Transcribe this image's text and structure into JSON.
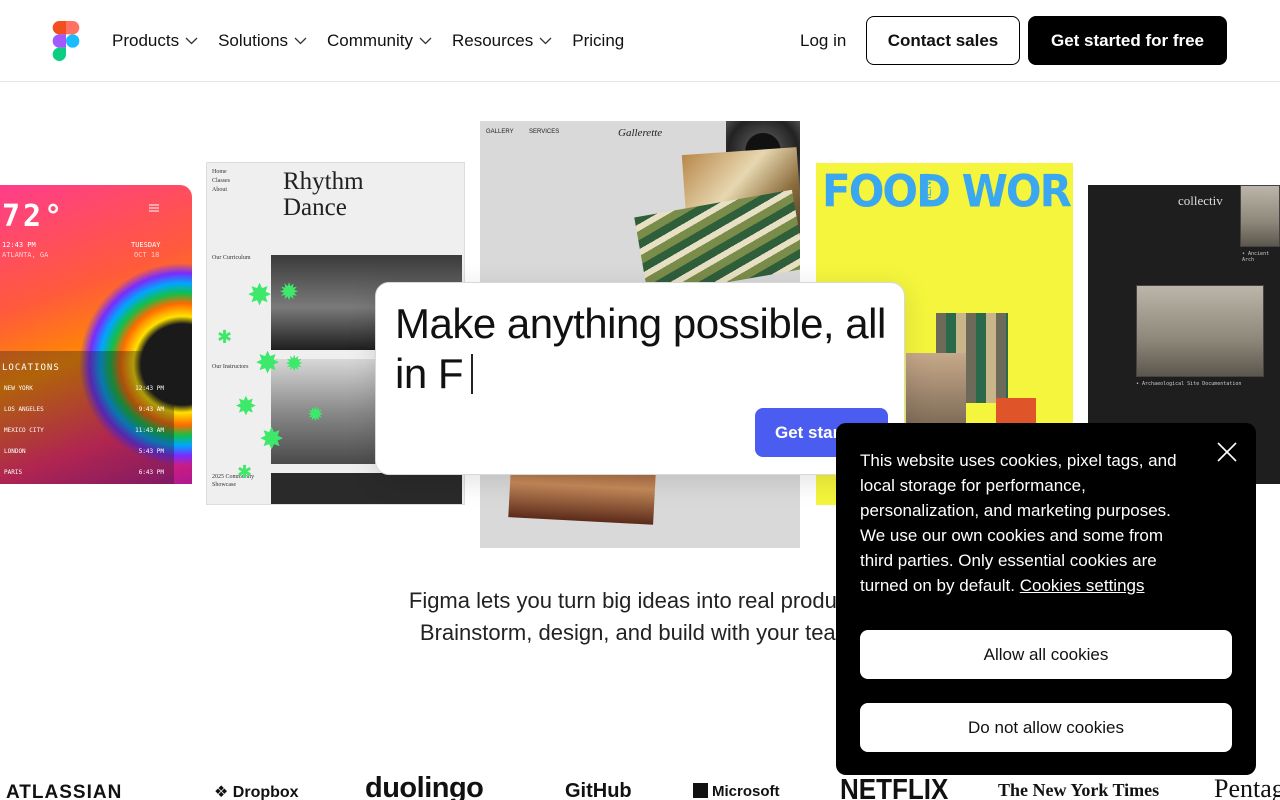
{
  "header": {
    "nav": [
      {
        "label": "Products",
        "dropdown": true
      },
      {
        "label": "Solutions",
        "dropdown": true
      },
      {
        "label": "Community",
        "dropdown": true
      },
      {
        "label": "Resources",
        "dropdown": true
      },
      {
        "label": "Pricing",
        "dropdown": false
      }
    ],
    "login": "Log in",
    "contact_sales": "Contact sales",
    "get_started": "Get started for free"
  },
  "collage": {
    "weather": {
      "temp": "72°",
      "time": "12:43 PM",
      "city": "ATLANTA, GA",
      "day": "TUESDAY",
      "date": "OCT 18",
      "locations_title": "LOCATIONS",
      "locations": [
        {
          "name": "NEW YORK",
          "time": "12:43 PM"
        },
        {
          "name": "LOS ANGELES",
          "time": "9:43 AM"
        },
        {
          "name": "MEXICO CITY",
          "time": "11:43 AM"
        },
        {
          "name": "LONDON",
          "time": "5:43 PM"
        },
        {
          "name": "PARIS",
          "time": "6:43 PM"
        }
      ]
    },
    "dance": {
      "menu": [
        "Home",
        "Classes",
        "About"
      ],
      "title_line1": "Rhythm",
      "title_line2": "Dance",
      "curriculum": "Our Curriculum",
      "instructors": "Our Instructors",
      "showcase_line1": "2025 Community",
      "showcase_line2": "Showcase"
    },
    "gallery": {
      "nav1": "GALLERY",
      "nav2": "SERVICES",
      "title": "Gallerette"
    },
    "food": {
      "title": "FOOD WORKS",
      "menu": "MENU"
    },
    "collectiv": {
      "title": "collectiv",
      "caption1": "• Ancient Arch",
      "caption2": "• Archaeological Site Documentation"
    }
  },
  "prompt": {
    "text": "Make anything possible, all in F",
    "button": "Get started"
  },
  "tagline": {
    "line1": "Figma lets you turn big ideas into real products.",
    "line2": "Brainstorm, design, and build with your team."
  },
  "logos": [
    "ATLASSIAN",
    "Dropbox",
    "duolingo",
    "GitHub",
    "Microsoft",
    "NETFLIX",
    "The New York Times",
    "Pentagram"
  ],
  "cookie": {
    "text": "This website uses cookies, pixel tags, and local storage for performance, personalization, and marketing purposes. We use our own cookies and some from third parties. Only essential cookies are turned on by default.",
    "settings_link": "Cookies settings",
    "allow": "Allow all cookies",
    "deny": "Do not allow cookies",
    "close_icon": "close-icon"
  },
  "colors": {
    "accent": "#4b5cf0",
    "figma_red": "#f24e1e",
    "figma_orange": "#ff7262",
    "figma_purple": "#a259ff",
    "figma_blue": "#1abcfe",
    "figma_green": "#0acf83"
  }
}
